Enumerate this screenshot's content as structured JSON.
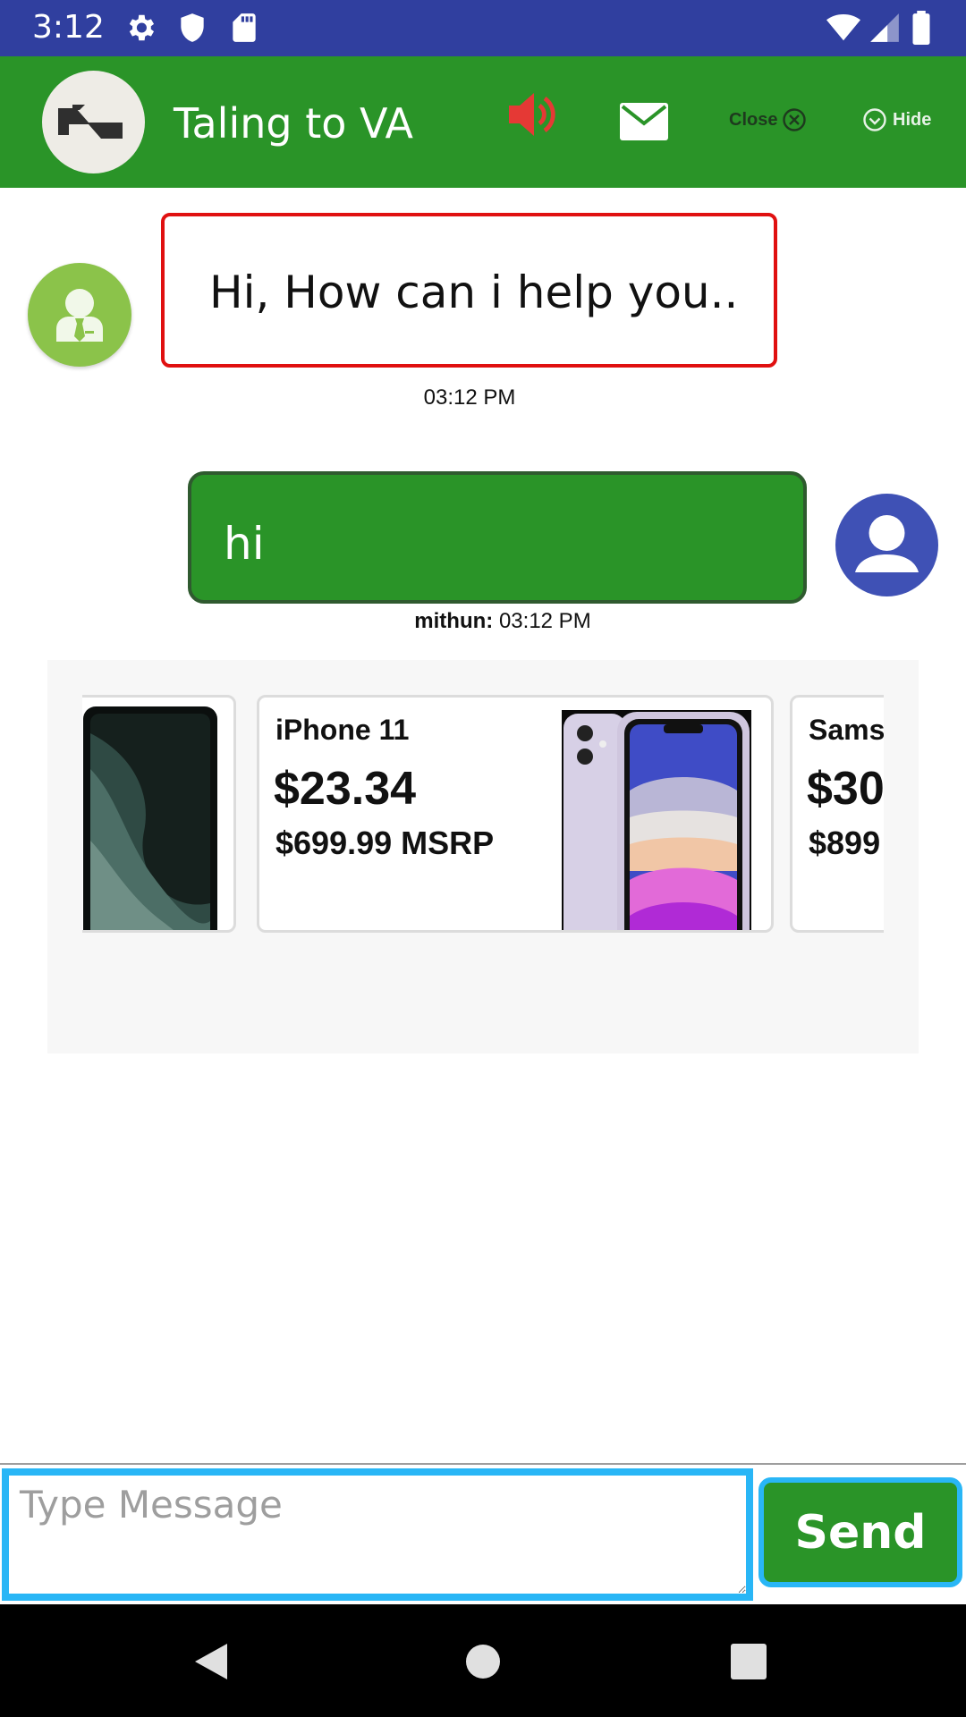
{
  "status_bar": {
    "time": "3:12",
    "icons_left": [
      "gear-icon",
      "shield-icon",
      "sd-card-icon"
    ],
    "icons_right": [
      "wifi-icon",
      "signal-icon",
      "battery-icon"
    ]
  },
  "header": {
    "title": "Taling to VA",
    "close_label": "Close",
    "hide_label": "Hide",
    "speaker_color": "#e53935",
    "background": "#2a9428"
  },
  "chat": {
    "bot_message": "Hi, How can i help you..",
    "bot_time": "03:12 PM",
    "user_message": "hi",
    "user_name": "mithun:",
    "user_time": "03:12 PM"
  },
  "carousel": {
    "cards": [
      {
        "name": "",
        "price": "",
        "msrp": ""
      },
      {
        "name": "iPhone 11",
        "price": "$23.34",
        "msrp": "$699.99 MSRP"
      },
      {
        "name": "Sams",
        "price": "$30",
        "msrp": "$899"
      }
    ]
  },
  "composer": {
    "placeholder": "Type Message",
    "send_label": "Send"
  }
}
